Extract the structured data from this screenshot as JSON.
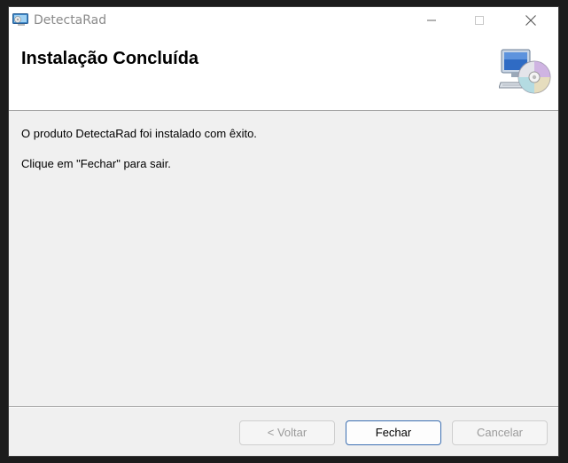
{
  "window": {
    "title": "DetectaRad",
    "icon": "installer-app-icon"
  },
  "titlebar_controls": {
    "minimize_icon": "minimize-icon",
    "maximize_icon": "maximize-icon",
    "close_icon": "close-icon"
  },
  "header": {
    "title": "Instalação Concluída",
    "icon": "computer-cd-icon"
  },
  "body": {
    "message": "O produto DetectaRad foi instalado com êxito.",
    "instruction": "Clique em \"Fechar\" para sair."
  },
  "buttons": {
    "back_label": "< Voltar",
    "close_label": "Fechar",
    "cancel_label": "Cancelar"
  },
  "colors": {
    "accent": "#3c6fb2",
    "disabled_text": "#9a9a9a"
  }
}
